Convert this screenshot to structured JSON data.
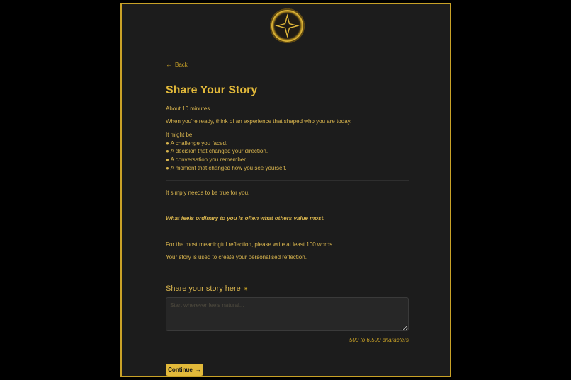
{
  "nav": {
    "back_label": "Back",
    "back_icon": "arrow-left-icon"
  },
  "page": {
    "title": "Share Your Story",
    "duration": "About 10 minutes",
    "intro": "When you're ready, think of an experience that shaped who you are today.",
    "list_heading": "It might be:",
    "list_items": [
      "● A challenge you faced.",
      "● A decision that changed your direction.",
      "● A conversation you remember.",
      "● A moment that changed how you see yourself."
    ],
    "truth_note": "It simply needs to be true for you.",
    "emphasis": "What feels ordinary to you is often what others value most.",
    "word_guidance": "For the most meaningful reflection, please write at least 100 words.",
    "usage_note": "Your story is used to create your personalised reflection."
  },
  "story": {
    "label": "Share your story here",
    "label_icon": "sparkle-icon",
    "placeholder": "Start wherever feels natural...",
    "value": "",
    "char_hint": "500 to 6,500 characters"
  },
  "actions": {
    "continue_label": "Continue",
    "continue_icon": "arrow-right-icon"
  },
  "colors": {
    "accent": "#e2b93a",
    "frame": "#c9a227",
    "background": "#1c1c1c",
    "page_bg": "#000000"
  }
}
